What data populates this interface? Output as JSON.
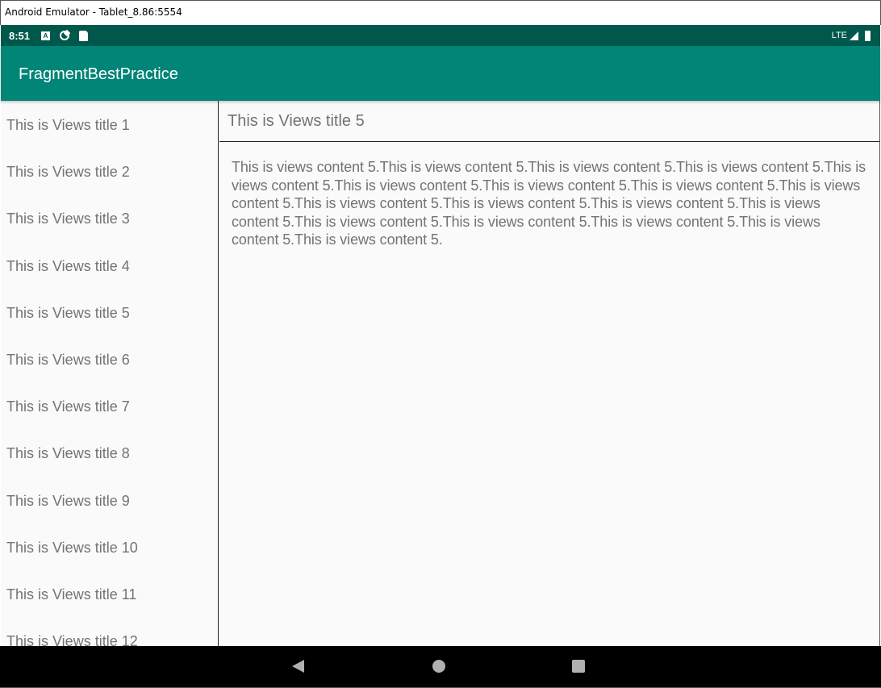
{
  "window": {
    "title": "Android Emulator - Tablet_8.86:5554"
  },
  "status_bar": {
    "time": "8:51",
    "network": "LTE",
    "icons": [
      "a-notification-icon",
      "settings-sync-icon",
      "sd-card-icon"
    ]
  },
  "app_bar": {
    "title": "FragmentBestPractice"
  },
  "list": {
    "items": [
      {
        "label": "This is Views title 1"
      },
      {
        "label": "This is Views title 2"
      },
      {
        "label": "This is Views title 3"
      },
      {
        "label": "This is Views title 4"
      },
      {
        "label": "This is Views title 5"
      },
      {
        "label": "This is Views title 6"
      },
      {
        "label": "This is Views title 7"
      },
      {
        "label": "This is Views title 8"
      },
      {
        "label": "This is Views title 9"
      },
      {
        "label": "This is Views title 10"
      },
      {
        "label": "This is Views title 11"
      },
      {
        "label": "This is Views title 12"
      }
    ]
  },
  "detail": {
    "title": "This is Views title 5",
    "content": "This is views content 5.This is views content 5.This is views content 5.This is views content 5.This is views content 5.This is views content 5.This is views content 5.This is views content 5.This is views content 5.This is views content 5.This is views content 5.This is views content 5.This is views content 5.This is views content 5.This is views content 5.This is views content 5.This is views content 5.This is views content 5."
  },
  "nav_bar": {
    "buttons": [
      "back",
      "home",
      "recents"
    ]
  }
}
